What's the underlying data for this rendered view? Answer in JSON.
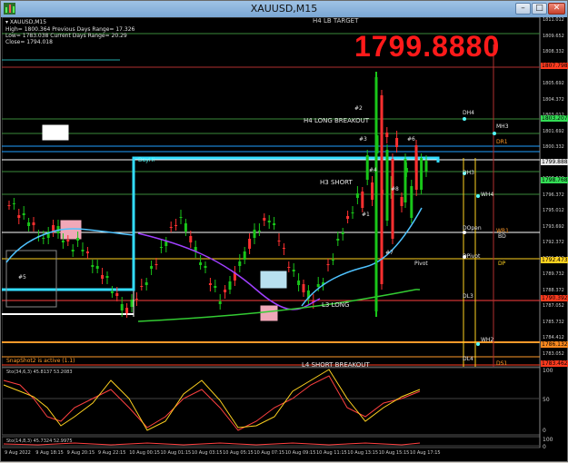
{
  "window": {
    "title": "XAUUSD,M15",
    "min": "–",
    "max": "□",
    "close": "✕"
  },
  "info": {
    "symbol": "▾ XAUUSD,M15",
    "line1": "High= 1800.364   Previous Days Range= 17.326",
    "line2": "Low= 1783.038    Current Days Range= 20.29",
    "line3": "Close= 1794.018"
  },
  "big_price": "1799.8880",
  "price_labels": [
    "1811.012",
    "1809.652",
    "1808.332",
    "1806.972",
    "1805.692",
    "1804.372",
    "1803.012",
    "1801.692",
    "1800.332",
    "1799.012",
    "1797.692",
    "1796.372",
    "1795.012",
    "1793.692",
    "1792.372",
    "1791.012",
    "1789.732",
    "1788.372",
    "1787.052",
    "1785.732",
    "1784.412",
    "1783.052"
  ],
  "price_tags": [
    {
      "text": "1807.798",
      "color": "#ff3b1f"
    },
    {
      "text": "1803.207",
      "color": "#33dd55"
    },
    {
      "text": "1799.888",
      "color": "#e6e6e6"
    },
    {
      "text": "1798.768",
      "color": "#33dd55"
    },
    {
      "text": "1792.473",
      "color": "#ffd21f"
    },
    {
      "text": "1790.392",
      "color": "#ff3b1f"
    },
    {
      "text": "1786.132",
      "color": "#ff8a1f"
    },
    {
      "text": "1783.462",
      "color": "#ff3b1f"
    }
  ],
  "time_labels": [
    "9 Aug 2022",
    "9 Aug 18:15",
    "9 Aug 20:15",
    "9 Aug 22:15",
    "10 Aug 00:15",
    "10 Aug 01:15",
    "10 Aug 03:15",
    "10 Aug 05:15",
    "10 Aug 07:15",
    "10 Aug 09:15",
    "10 Aug 11:15",
    "10 Aug 13:15",
    "10 Aug 15:15",
    "10 Aug 17:15"
  ],
  "levels": {
    "h4_target": "H4 LB TARGET",
    "h4_breakout": "H4 LONG BREAKOUT",
    "h3_short": "H3 SHORT",
    "l3_long": "L3 LONG",
    "l4_breakout": "L4 SHORT BREAKOUT",
    "day_high": "DayHi",
    "dh4": "DH4",
    "dh3": "DH3",
    "dopen": "DOpen",
    "dpivot": "DPivot",
    "pivot": "Pivot",
    "dl3": "DL3",
    "dl4": "DL4",
    "mh3": "MH3",
    "dr1": "DR1",
    "wh4": "WH4",
    "wr1": "WR1",
    "bd": "BD",
    "dp": "DP",
    "wh2": "WH2",
    "ds1": "DS1",
    "snapshot": "SnapShot2 is active (1.1)"
  },
  "markers": [
    "#2",
    "#3",
    "#4",
    "#6",
    "#8",
    "#1",
    "#7",
    "#5"
  ],
  "indicator1": {
    "label": "Sto(34,6,3) 45.8137 53.2083",
    "levels": [
      "100",
      "50",
      "0"
    ]
  },
  "indicator2": {
    "label": "Sto(14,8,3) 45.7324 52.9975",
    "levels": [
      "100",
      "0"
    ]
  },
  "colors": {
    "up": "#19c619",
    "down": "#ff3030",
    "accent": "#1fa0ff",
    "sma_fast": "#a040ff",
    "sma_slow": "#33cc33",
    "cyan": "#33ddff"
  }
}
